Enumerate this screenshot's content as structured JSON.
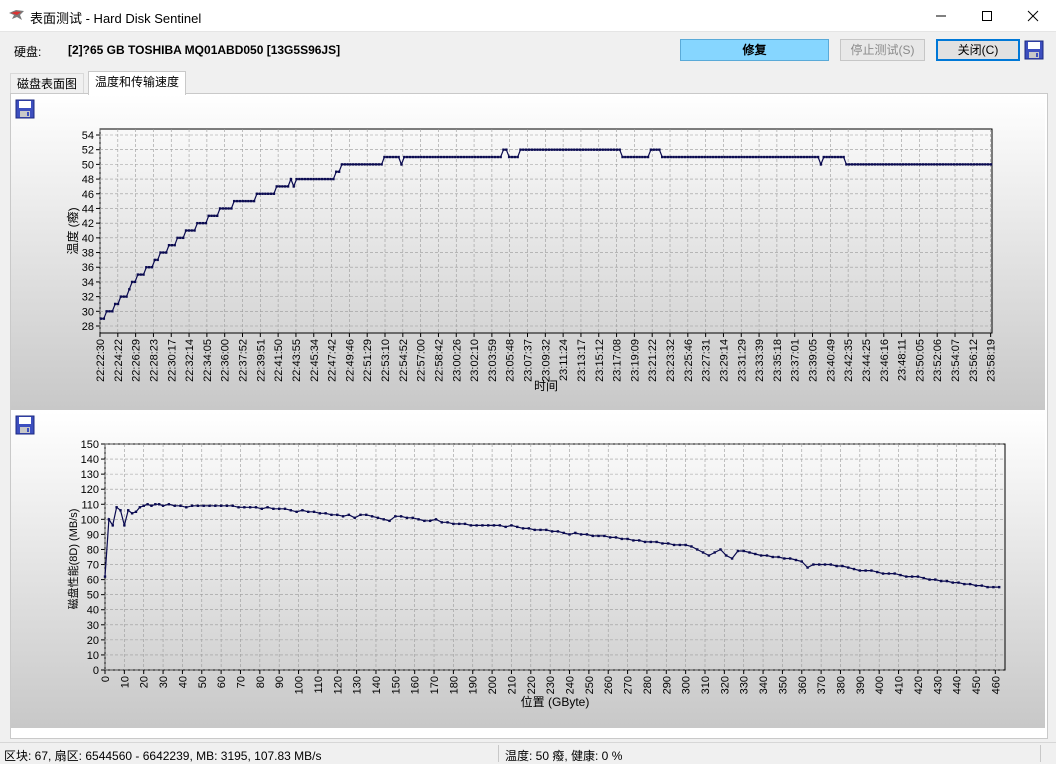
{
  "window": {
    "title": "表面测试 - Hard Disk Sentinel"
  },
  "header": {
    "disk_label": "硬盘:",
    "disk_name": "[2]?65 GB  TOSHIBA MQ01ABD050 [13G5S96JS]",
    "repair_label": "修复",
    "stop_label": "停止测试(S)",
    "close_label": "关闭(C)"
  },
  "tabs": [
    {
      "label": "磁盘表面图",
      "active": false
    },
    {
      "label": "温度和传输速度",
      "active": true
    }
  ],
  "status": {
    "left": "区块: 67, 扇区: 6544560 - 6642239, MB: 3195, 107.83 MB/s",
    "right": "温度: 50  癈,  健康:   0 %"
  },
  "chart_data": [
    {
      "type": "line",
      "xlabel": "时间",
      "ylabel": "温度 (癈)",
      "ylim": [
        28,
        54
      ],
      "yticks": [
        28,
        30,
        32,
        34,
        36,
        38,
        40,
        42,
        44,
        46,
        48,
        50,
        52,
        54
      ],
      "x_tick_labels": [
        "22:22:30",
        "22:24:22",
        "22:26:29",
        "22:28:23",
        "22:30:17",
        "22:32:14",
        "22:34:05",
        "22:36:00",
        "22:37:52",
        "22:39:51",
        "22:41:50",
        "22:43:55",
        "22:45:34",
        "22:47:42",
        "22:49:46",
        "22:51:29",
        "22:53:10",
        "22:54:52",
        "22:57:00",
        "22:58:42",
        "23:00:26",
        "23:02:10",
        "23:03:59",
        "23:05:48",
        "23:07:37",
        "23:09:32",
        "23:11:24",
        "23:13:17",
        "23:15:12",
        "23:17:08",
        "23:19:09",
        "23:21:22",
        "23:23:32",
        "23:25:46",
        "23:27:31",
        "23:29:14",
        "23:31:29",
        "23:33:39",
        "23:35:18",
        "23:37:01",
        "23:39:05",
        "23:40:49",
        "23:42:35",
        "23:44:25",
        "23:46:16",
        "23:48:11",
        "23:50:05",
        "23:52:06",
        "23:54:07",
        "23:56:12",
        "23:58:19"
      ],
      "grid": true,
      "series": [
        {
          "values": [
            29,
            29,
            30,
            30,
            30,
            31,
            31,
            32,
            32,
            32,
            33,
            34,
            34,
            35,
            35,
            35,
            36,
            36,
            36,
            37,
            37,
            38,
            38,
            38,
            39,
            39,
            39,
            40,
            40,
            40,
            41,
            41,
            41,
            41,
            42,
            42,
            42,
            42,
            43,
            43,
            43,
            43,
            44,
            44,
            44,
            44,
            44,
            45,
            45,
            45,
            45,
            45,
            45,
            45,
            45,
            46,
            46,
            46,
            46,
            46,
            46,
            46,
            47,
            47,
            47,
            47,
            47,
            48,
            47,
            48,
            48,
            48,
            48,
            48,
            48,
            48,
            48,
            48,
            48,
            48,
            48,
            48,
            48,
            49,
            49,
            50,
            50,
            50,
            50,
            50,
            50,
            50,
            50,
            50,
            50,
            50,
            50,
            50,
            50,
            50,
            51,
            51,
            51,
            51,
            51,
            51,
            50,
            51,
            51,
            51,
            51,
            51,
            51,
            51,
            51,
            51,
            51,
            51,
            51,
            51,
            51,
            51,
            51,
            51,
            51,
            51,
            51,
            51,
            51,
            51,
            51,
            51,
            51,
            51,
            51,
            51,
            51,
            51,
            51,
            51,
            51,
            51,
            52,
            52,
            51,
            51,
            51,
            51,
            52,
            52,
            52,
            52,
            52,
            52,
            52,
            52,
            52,
            52,
            52,
            52,
            52,
            52,
            52,
            52,
            52,
            52,
            52,
            52,
            52,
            52,
            52,
            52,
            52,
            52,
            52,
            52,
            52,
            52,
            52,
            52,
            52,
            52,
            52,
            52,
            51,
            51,
            51,
            51,
            51,
            51,
            51,
            51,
            51,
            51,
            52,
            52,
            52,
            52,
            51,
            51,
            51,
            51,
            51,
            51,
            51,
            51,
            51,
            51,
            51,
            51,
            51,
            51,
            51,
            51,
            51,
            51,
            51,
            51,
            51,
            51,
            51,
            51,
            51,
            51,
            51,
            51,
            51,
            51,
            51,
            51,
            51,
            51,
            51,
            51,
            51,
            51,
            51,
            51,
            51,
            51,
            51,
            51,
            51,
            51,
            51,
            51,
            51,
            51,
            51,
            51,
            51,
            51,
            51,
            51,
            50,
            51,
            51,
            51,
            51,
            51,
            51,
            51,
            51,
            50,
            50,
            50,
            50,
            50,
            50,
            50,
            50,
            50,
            50,
            50,
            50,
            50,
            50,
            50,
            50,
            50,
            50,
            50,
            50,
            50,
            50,
            50,
            50,
            50,
            50,
            50,
            50,
            50,
            50,
            50,
            50,
            50,
            50,
            50,
            50,
            50,
            50,
            50,
            50,
            50,
            50,
            50,
            50,
            50,
            50,
            50,
            50,
            50,
            50,
            50,
            50
          ]
        }
      ]
    },
    {
      "type": "line",
      "xlabel": "位置 (GByte)",
      "ylabel": "磁盘性能(8D) (MB/s)",
      "ylim": [
        0,
        150
      ],
      "yticks": [
        0,
        10,
        20,
        30,
        40,
        50,
        60,
        70,
        80,
        90,
        100,
        110,
        120,
        130,
        140,
        150
      ],
      "xlim": [
        0,
        465
      ],
      "xticks": [
        0,
        10,
        20,
        30,
        40,
        50,
        60,
        70,
        80,
        90,
        100,
        110,
        120,
        130,
        140,
        150,
        160,
        170,
        180,
        190,
        200,
        210,
        220,
        230,
        240,
        250,
        260,
        270,
        280,
        290,
        300,
        310,
        320,
        330,
        340,
        350,
        360,
        370,
        380,
        390,
        400,
        410,
        420,
        430,
        440,
        450,
        460
      ],
      "grid": true,
      "series": [
        {
          "x": [
            0,
            2,
            4,
            6,
            8,
            10,
            12,
            14,
            16,
            18,
            20,
            22,
            24,
            26,
            28,
            30,
            33,
            36,
            39,
            42,
            45,
            48,
            51,
            54,
            57,
            60,
            63,
            66,
            69,
            72,
            75,
            78,
            81,
            84,
            87,
            90,
            93,
            96,
            99,
            102,
            105,
            108,
            111,
            114,
            117,
            120,
            123,
            126,
            129,
            132,
            135,
            138,
            141,
            144,
            147,
            150,
            153,
            156,
            159,
            162,
            165,
            168,
            171,
            174,
            177,
            180,
            183,
            186,
            189,
            192,
            195,
            198,
            201,
            204,
            207,
            210,
            213,
            216,
            219,
            222,
            225,
            228,
            231,
            234,
            237,
            240,
            243,
            246,
            249,
            252,
            255,
            258,
            261,
            264,
            267,
            270,
            273,
            276,
            279,
            282,
            285,
            288,
            291,
            294,
            297,
            300,
            303,
            306,
            309,
            312,
            315,
            318,
            321,
            324,
            327,
            330,
            333,
            336,
            339,
            342,
            345,
            348,
            351,
            354,
            357,
            360,
            363,
            366,
            369,
            372,
            375,
            378,
            381,
            384,
            387,
            390,
            393,
            396,
            399,
            402,
            405,
            408,
            411,
            414,
            417,
            420,
            423,
            426,
            429,
            432,
            435,
            438,
            441,
            444,
            447,
            450,
            453,
            456,
            459,
            462
          ],
          "values": [
            62,
            100,
            96,
            108,
            106,
            96,
            106,
            104,
            105,
            108,
            109,
            110,
            109,
            110,
            110,
            109,
            110,
            109,
            109,
            108,
            109,
            109,
            109,
            109,
            109,
            109,
            109,
            109,
            108,
            108,
            108,
            108,
            107,
            108,
            107,
            107,
            107,
            106,
            105,
            106,
            105,
            105,
            104,
            104,
            103,
            103,
            102,
            103,
            101,
            103,
            103,
            102,
            101,
            100,
            99,
            102,
            102,
            101,
            101,
            100,
            99,
            99,
            100,
            98,
            98,
            97,
            97,
            97,
            96,
            96,
            96,
            96,
            96,
            96,
            95,
            96,
            95,
            94,
            94,
            93,
            93,
            93,
            92,
            92,
            91,
            90,
            91,
            90,
            90,
            89,
            89,
            89,
            88,
            88,
            87,
            87,
            86,
            86,
            85,
            85,
            85,
            84,
            84,
            83,
            83,
            83,
            82,
            80,
            78,
            76,
            78,
            80,
            76,
            74,
            79,
            79,
            78,
            77,
            76,
            76,
            75,
            75,
            74,
            74,
            73,
            72,
            68,
            70,
            70,
            70,
            70,
            69,
            69,
            68,
            67,
            66,
            66,
            66,
            65,
            64,
            64,
            64,
            63,
            62,
            62,
            62,
            61,
            60,
            60,
            59,
            59,
            58,
            58,
            57,
            57,
            56,
            56,
            55,
            55,
            55
          ]
        }
      ]
    }
  ],
  "colors": {
    "repair_bg": "#86d6ff",
    "line": "#0a0a50",
    "grid": "#9a9a9a"
  }
}
